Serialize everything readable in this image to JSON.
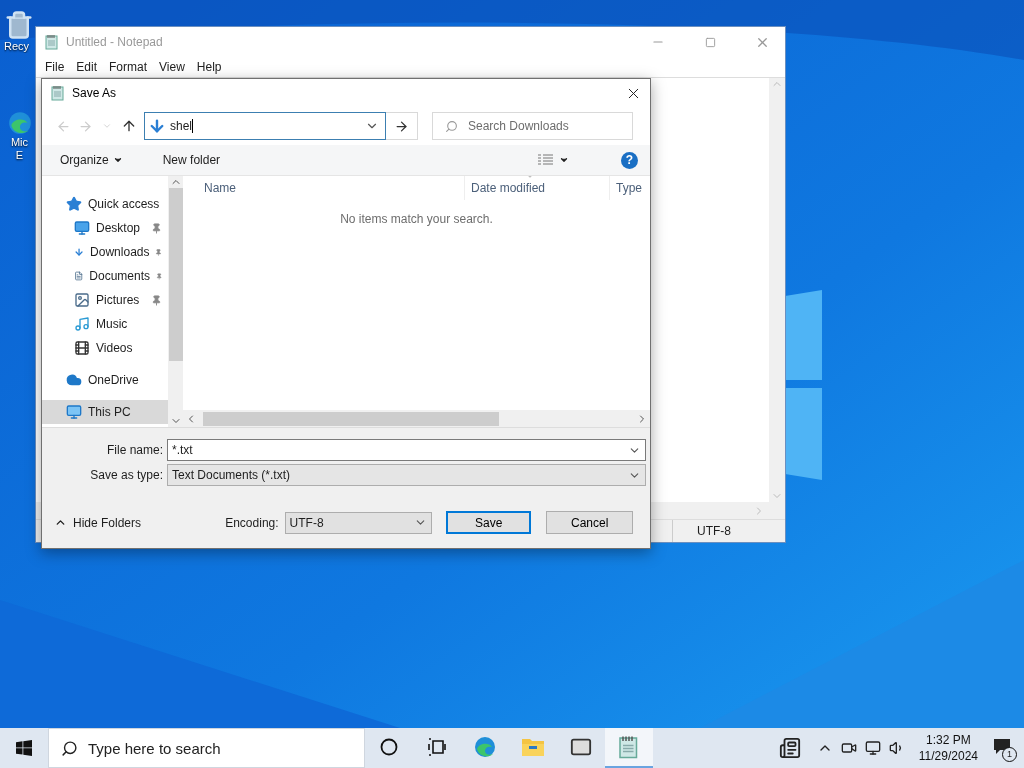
{
  "desktop": {
    "icons": [
      {
        "kind": "recycle_bin",
        "lines": [
          "Recy"
        ]
      },
      {
        "kind": "edge",
        "lines": [
          "Mic",
          "E"
        ]
      }
    ]
  },
  "notepad": {
    "title": "Untitled - Notepad",
    "active": false,
    "menu": [
      "File",
      "Edit",
      "Format",
      "View",
      "Help"
    ],
    "status_encoding": "UTF-8"
  },
  "dialog": {
    "title": "Save As",
    "address": {
      "value": "shel"
    },
    "search": {
      "placeholder": "Search Downloads"
    },
    "toolbar": {
      "organize": "Organize",
      "new_folder": "New folder",
      "help": "?"
    },
    "nav": [
      {
        "label": "Quick access",
        "kind": "star",
        "selected": false,
        "pinned": false,
        "children": [
          {
            "label": "Desktop",
            "kind": "desktop",
            "selected": false,
            "pinned": true
          },
          {
            "label": "Downloads",
            "kind": "download",
            "selected": false,
            "pinned": true
          },
          {
            "label": "Documents",
            "kind": "document",
            "selected": false,
            "pinned": true
          },
          {
            "label": "Pictures",
            "kind": "pictures",
            "selected": false,
            "pinned": true
          },
          {
            "label": "Music",
            "kind": "music",
            "selected": false,
            "pinned": false
          },
          {
            "label": "Videos",
            "kind": "videos",
            "selected": false,
            "pinned": false
          }
        ]
      },
      {
        "label": "OneDrive",
        "kind": "cloud",
        "selected": false,
        "pinned": false
      },
      {
        "label": "This PC",
        "kind": "pc",
        "selected": true,
        "pinned": false
      }
    ],
    "columns": [
      "Name",
      "Date modified",
      "Type"
    ],
    "empty_message": "No items match your search.",
    "file_name": {
      "label": "File name:",
      "value": "*.txt"
    },
    "save_as_type": {
      "label": "Save as type:",
      "value": "Text Documents (*.txt)"
    },
    "hide_folders": "Hide Folders",
    "encoding": {
      "label": "Encoding:",
      "value": "UTF-8"
    },
    "buttons": [
      {
        "label": "Save",
        "default": true
      },
      {
        "label": "Cancel",
        "default": false
      }
    ]
  },
  "taskbar": {
    "search_placeholder": "Type here to search",
    "apps": [
      {
        "kind": "cortana",
        "selected": false
      },
      {
        "kind": "task_view",
        "selected": false
      },
      {
        "kind": "edge",
        "selected": false
      },
      {
        "kind": "explorer",
        "selected": false
      },
      {
        "kind": "mail",
        "selected": false
      },
      {
        "kind": "notepad",
        "selected": true
      }
    ],
    "time": "1:32 PM",
    "date": "11/29/2024",
    "notifications": "1"
  }
}
